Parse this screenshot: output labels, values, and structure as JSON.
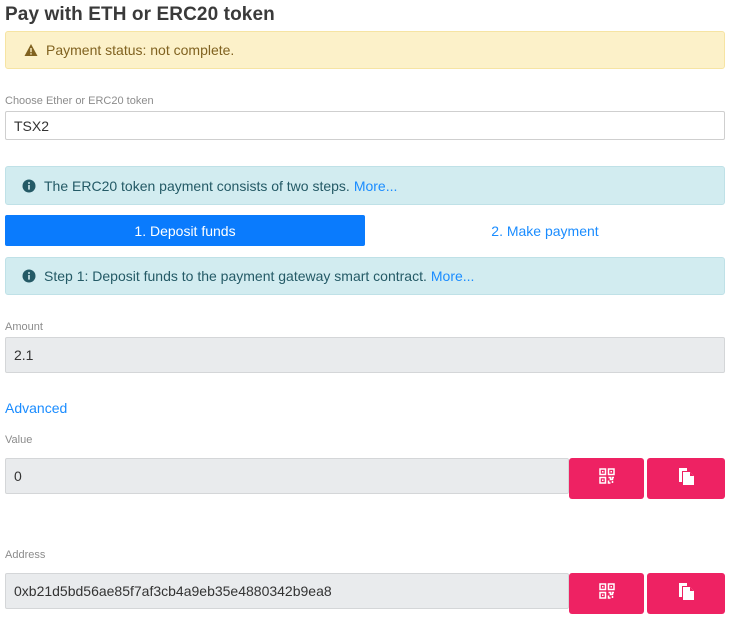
{
  "page": {
    "title": "Pay with ETH or ERC20 token"
  },
  "status_alert": {
    "icon": "warning-icon",
    "text": "Payment status: not complete."
  },
  "token": {
    "label": "Choose Ether or ERC20 token",
    "value": "TSX2"
  },
  "info_alert": {
    "icon": "info-icon",
    "text": "The ERC20 token payment consists of two steps.",
    "link": "More..."
  },
  "steps": {
    "step1": "1. Deposit funds",
    "step2": "2. Make payment"
  },
  "step_alert": {
    "icon": "info-icon",
    "text": "Step 1: Deposit funds to the payment gateway smart contract.",
    "link": "More..."
  },
  "amount": {
    "label": "Amount",
    "value": "2.1"
  },
  "advanced": {
    "label": "Advanced"
  },
  "value_field": {
    "label": "Value",
    "value": "0"
  },
  "address_field": {
    "label": "Address",
    "value": "0xb21d5bd56ae85f7af3cb4a9eb35e4880342b9ea8"
  },
  "colors": {
    "primary": "#0a7bfd",
    "accent": "#ee2263",
    "link": "#1a8cff",
    "warning_bg": "#fcf1c9",
    "info_bg": "#d2ecf0"
  }
}
